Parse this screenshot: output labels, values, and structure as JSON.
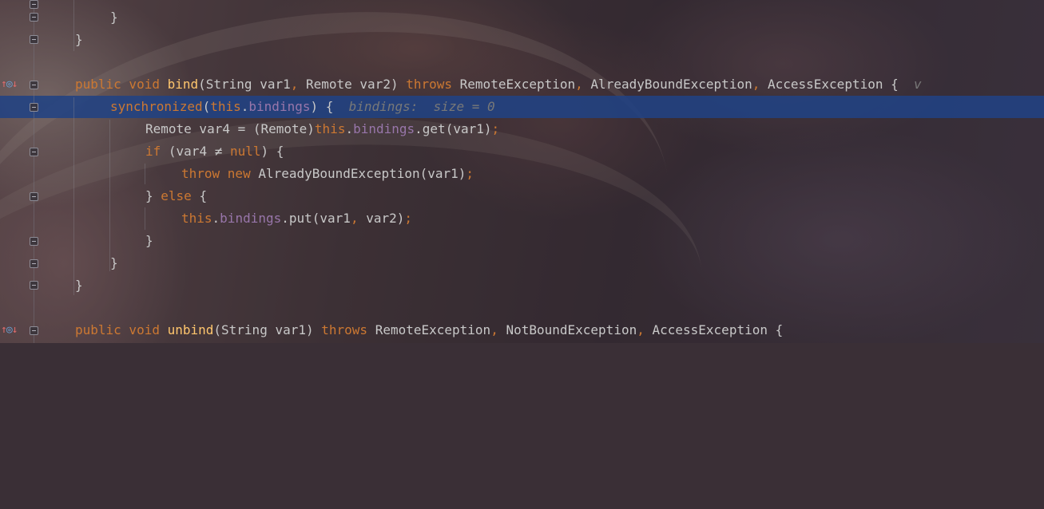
{
  "editor": {
    "highlight_color": "#214283",
    "lines": [
      [
        {
          "t": "}",
          "c": "plain"
        }
      ],
      [
        {
          "t": "}",
          "c": "plain"
        }
      ],
      [
        {
          "t": "public void ",
          "c": "kw"
        },
        {
          "t": "bind",
          "c": "fn"
        },
        {
          "t": "(String var1",
          "c": "plain"
        },
        {
          "t": ", ",
          "c": "kw"
        },
        {
          "t": "Remote var2) ",
          "c": "plain"
        },
        {
          "t": "throws ",
          "c": "kw"
        },
        {
          "t": "RemoteException",
          "c": "plain"
        },
        {
          "t": ", ",
          "c": "kw"
        },
        {
          "t": "AlreadyBoundException",
          "c": "plain"
        },
        {
          "t": ", ",
          "c": "kw"
        },
        {
          "t": "AccessException {  ",
          "c": "plain"
        },
        {
          "t": "v",
          "c": "hint"
        }
      ],
      [
        {
          "t": "synchronized",
          "c": "kw"
        },
        {
          "t": "(",
          "c": "plain"
        },
        {
          "t": "this",
          "c": "kw"
        },
        {
          "t": ".",
          "c": "plain"
        },
        {
          "t": "bindings",
          "c": "fld"
        },
        {
          "t": ") {  ",
          "c": "plain"
        },
        {
          "t": "bindings:  size = 0",
          "c": "hint"
        }
      ],
      [
        {
          "t": "Remote var4 = (Remote)",
          "c": "plain"
        },
        {
          "t": "this",
          "c": "kw"
        },
        {
          "t": ".",
          "c": "plain"
        },
        {
          "t": "bindings",
          "c": "fld"
        },
        {
          "t": ".get(var1)",
          "c": "plain"
        },
        {
          "t": ";",
          "c": "kw"
        }
      ],
      [
        {
          "t": "if ",
          "c": "kw"
        },
        {
          "t": "(var4 ≠ ",
          "c": "plain"
        },
        {
          "t": "null",
          "c": "kw"
        },
        {
          "t": ") {",
          "c": "plain"
        }
      ],
      [
        {
          "t": "throw new ",
          "c": "kw"
        },
        {
          "t": "AlreadyBoundException(var1)",
          "c": "plain"
        },
        {
          "t": ";",
          "c": "kw"
        }
      ],
      [
        {
          "t": "} ",
          "c": "plain"
        },
        {
          "t": "else ",
          "c": "kw"
        },
        {
          "t": "{",
          "c": "plain"
        }
      ],
      [
        {
          "t": "this",
          "c": "kw"
        },
        {
          "t": ".",
          "c": "plain"
        },
        {
          "t": "bindings",
          "c": "fld"
        },
        {
          "t": ".put(var1",
          "c": "plain"
        },
        {
          "t": ", ",
          "c": "kw"
        },
        {
          "t": "var2)",
          "c": "plain"
        },
        {
          "t": ";",
          "c": "kw"
        }
      ],
      [
        {
          "t": "}",
          "c": "plain"
        }
      ],
      [
        {
          "t": "}",
          "c": "plain"
        }
      ],
      [
        {
          "t": "}",
          "c": "plain"
        }
      ],
      [],
      [
        {
          "t": "public void ",
          "c": "kw"
        },
        {
          "t": "unbind",
          "c": "fn"
        },
        {
          "t": "(String var1) ",
          "c": "plain"
        },
        {
          "t": "throws ",
          "c": "kw"
        },
        {
          "t": "RemoteException",
          "c": "plain"
        },
        {
          "t": ", ",
          "c": "kw"
        },
        {
          "t": "NotBoundException",
          "c": "plain"
        },
        {
          "t": ", ",
          "c": "kw"
        },
        {
          "t": "AccessException {",
          "c": "plain"
        }
      ]
    ],
    "gutter_markers": [
      {
        "icon_names": [
          "override-marker-icon",
          "implements-marker-icon",
          "down-arrow-icon"
        ]
      },
      {
        "icon_names": [
          "override-marker-icon",
          "implements-marker-icon",
          "down-arrow-icon"
        ]
      }
    ]
  }
}
